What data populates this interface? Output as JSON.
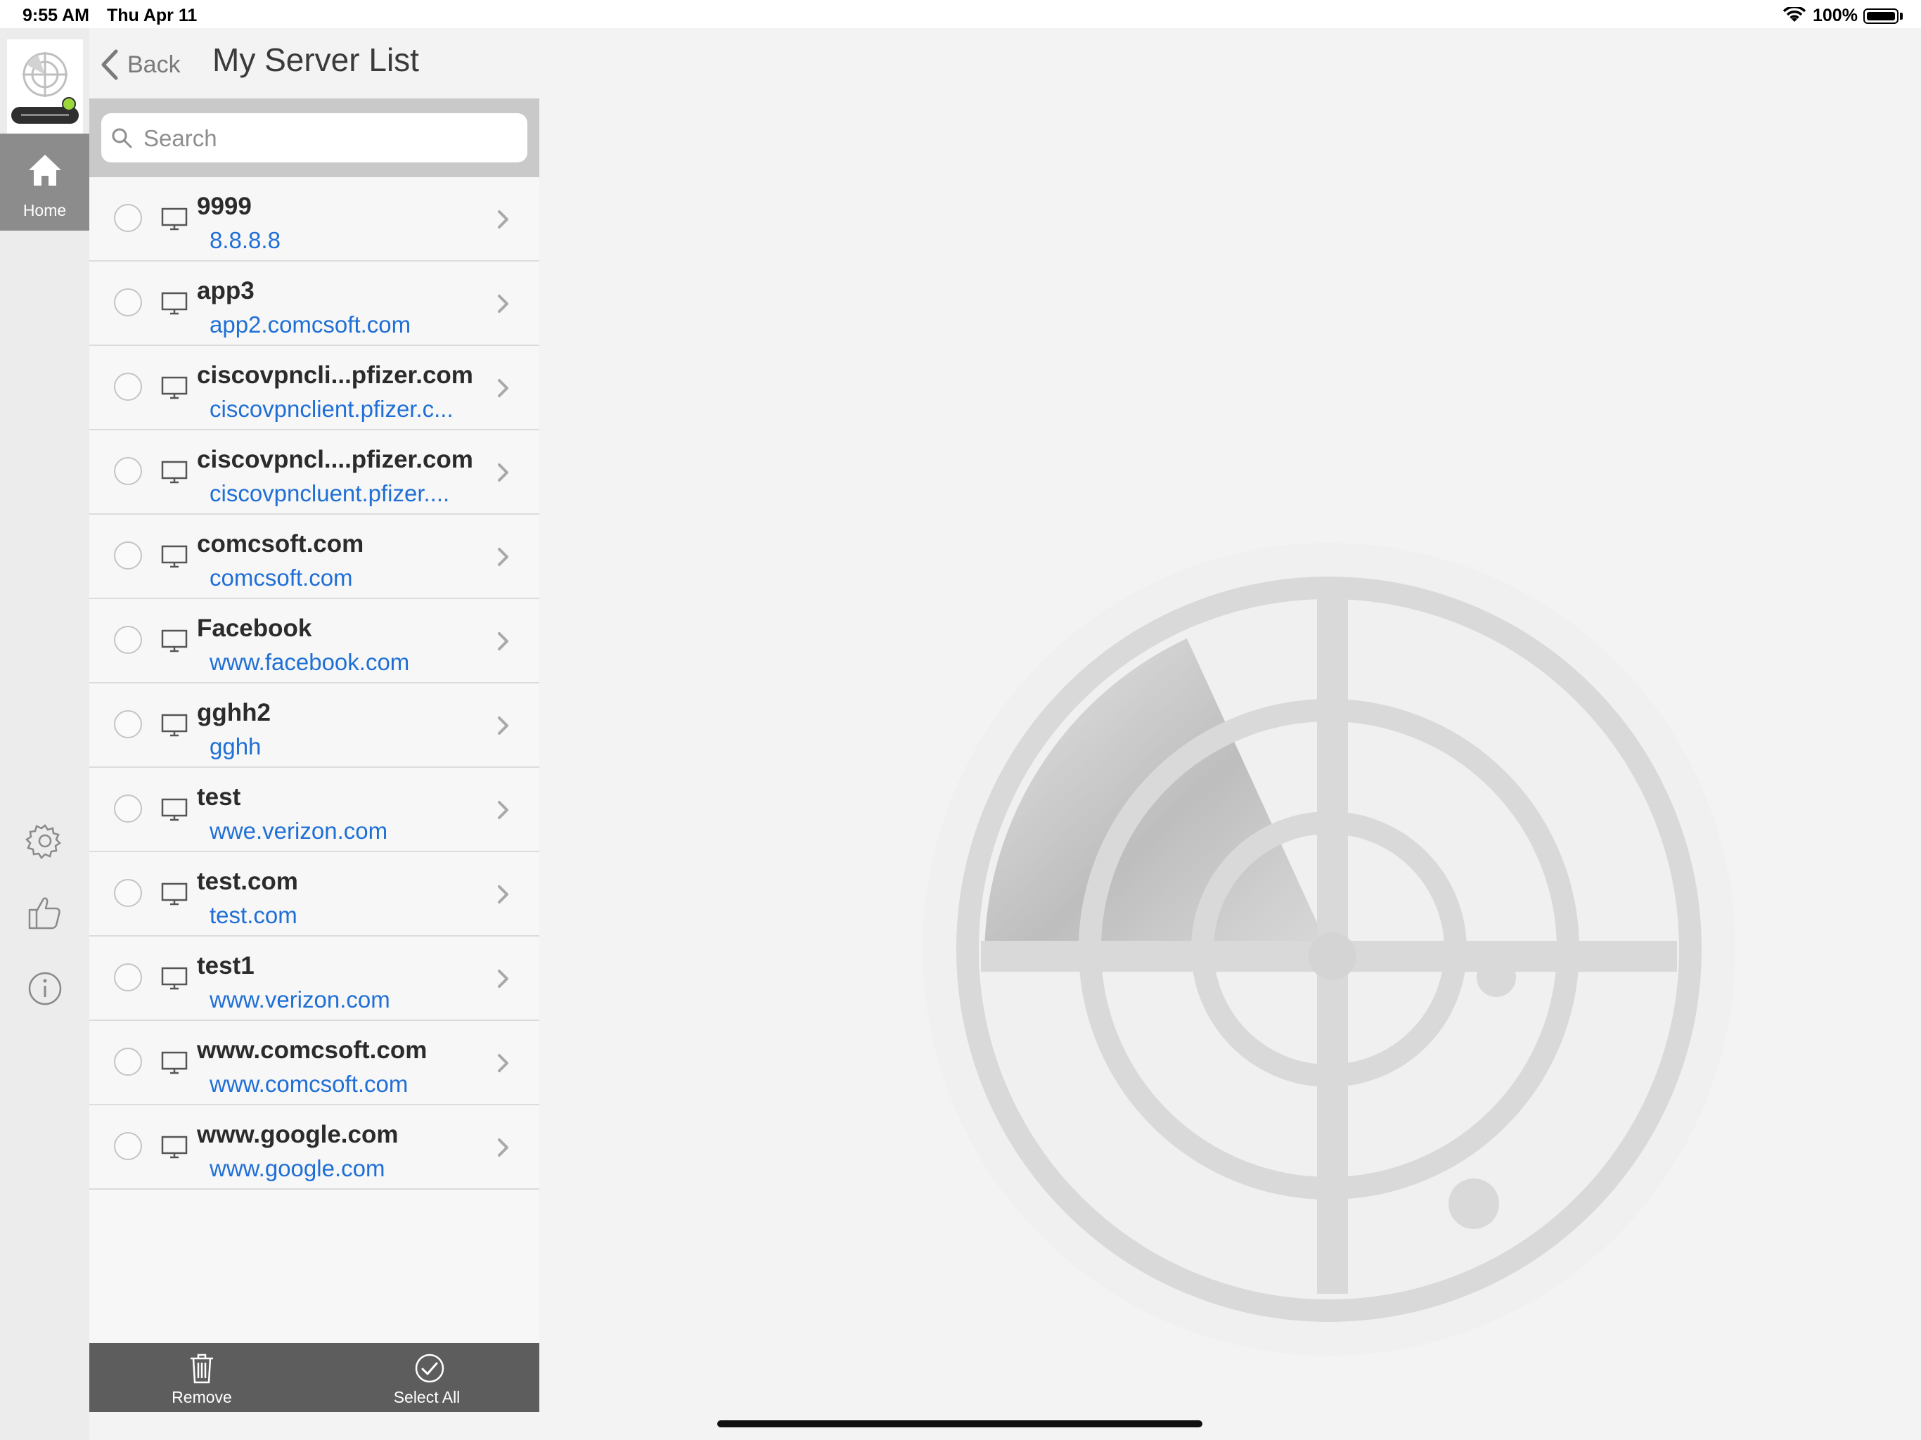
{
  "status_bar": {
    "time": "9:55 AM",
    "date": "Thu Apr 11",
    "battery_percent": "100%"
  },
  "sidebar": {
    "home_label": "Home",
    "icons": [
      "settings-icon",
      "thumbs-up-icon",
      "info-icon"
    ]
  },
  "header": {
    "back_label": "Back",
    "title": "My Server List"
  },
  "search": {
    "placeholder": "Search"
  },
  "servers": [
    {
      "name": "9999",
      "host": "8.8.8.8"
    },
    {
      "name": "app3",
      "host": "app2.comcsoft.com"
    },
    {
      "name": "ciscovpncli...pfizer.com",
      "host": "ciscovpnclient.pfizer.c..."
    },
    {
      "name": "ciscovpncl....pfizer.com",
      "host": "ciscovpncluent.pfizer...."
    },
    {
      "name": "comcsoft.com",
      "host": "comcsoft.com"
    },
    {
      "name": "Facebook",
      "host": "www.facebook.com"
    },
    {
      "name": "gghh2",
      "host": "gghh"
    },
    {
      "name": "test",
      "host": "wwe.verizon.com"
    },
    {
      "name": "test.com",
      "host": "test.com"
    },
    {
      "name": "test1",
      "host": "www.verizon.com"
    },
    {
      "name": "www.comcsoft.com",
      "host": "www.comcsoft.com"
    },
    {
      "name": "www.google.com",
      "host": "www.google.com"
    }
  ],
  "toolbar": {
    "remove_label": "Remove",
    "select_all_label": "Select All"
  },
  "colors": {
    "link": "#1f6fd6",
    "toolbar_bg": "#5d5d5d",
    "rail_selected": "#8c8c8c"
  }
}
